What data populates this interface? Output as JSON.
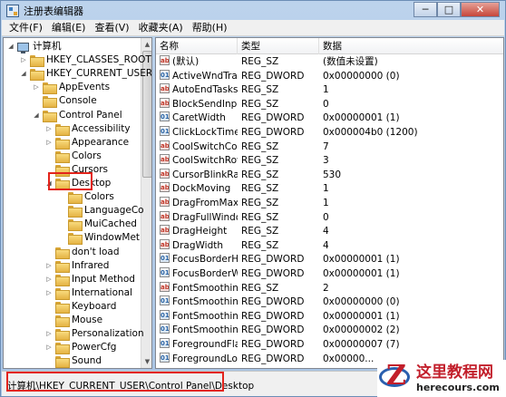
{
  "window": {
    "title": "注册表编辑器",
    "minimize": "─",
    "maximize": "□",
    "close": "✕"
  },
  "menu": [
    "文件(F)",
    "编辑(E)",
    "查看(V)",
    "收藏夹(A)",
    "帮助(H)"
  ],
  "tree": [
    {
      "label": "计算机",
      "icon": "computer-icon",
      "expander": "◢"
    },
    {
      "label": "HKEY_CLASSES_ROOT",
      "expander": "▷"
    },
    {
      "label": "HKEY_CURRENT_USER",
      "expander": "◢"
    },
    {
      "label": "AppEvents",
      "expander": "▷"
    },
    {
      "label": "Console",
      "expander": ""
    },
    {
      "label": "Control Panel",
      "expander": "◢"
    },
    {
      "label": "Accessibility",
      "expander": "▷"
    },
    {
      "label": "Appearance",
      "expander": "▷"
    },
    {
      "label": "Colors",
      "expander": ""
    },
    {
      "label": "Cursors",
      "expander": ""
    },
    {
      "label": "Desktop",
      "expander": "◢"
    },
    {
      "label": "Colors",
      "expander": ""
    },
    {
      "label": "LanguageCo",
      "expander": ""
    },
    {
      "label": "MuiCached",
      "expander": ""
    },
    {
      "label": "WindowMet",
      "expander": ""
    },
    {
      "label": "don't load",
      "expander": ""
    },
    {
      "label": "Infrared",
      "expander": "▷"
    },
    {
      "label": "Input Method",
      "expander": "▷"
    },
    {
      "label": "International",
      "expander": "▷"
    },
    {
      "label": "Keyboard",
      "expander": ""
    },
    {
      "label": "Mouse",
      "expander": ""
    },
    {
      "label": "Personalization",
      "expander": "▷"
    },
    {
      "label": "PowerCfg",
      "expander": "▷"
    },
    {
      "label": "Sound",
      "expander": ""
    }
  ],
  "list": {
    "headers": {
      "name": "名称",
      "type": "类型",
      "data": "数据"
    },
    "rows": [
      {
        "name": "(默认)",
        "type": "REG_SZ",
        "data": "(数值未设置)",
        "icon": "string-value-icon"
      },
      {
        "name": "ActiveWndTrac...",
        "type": "REG_DWORD",
        "data": "0x00000000 (0)",
        "icon": "dword-value-icon"
      },
      {
        "name": "AutoEndTasks",
        "type": "REG_SZ",
        "data": "1",
        "icon": "string-value-icon"
      },
      {
        "name": "BlockSendInpu...",
        "type": "REG_SZ",
        "data": "0",
        "icon": "string-value-icon"
      },
      {
        "name": "CaretWidth",
        "type": "REG_DWORD",
        "data": "0x00000001 (1)",
        "icon": "dword-value-icon"
      },
      {
        "name": "ClickLockTime",
        "type": "REG_DWORD",
        "data": "0x000004b0 (1200)",
        "icon": "dword-value-icon"
      },
      {
        "name": "CoolSwitchCol...",
        "type": "REG_SZ",
        "data": "7",
        "icon": "string-value-icon"
      },
      {
        "name": "CoolSwitchRows",
        "type": "REG_SZ",
        "data": "3",
        "icon": "string-value-icon"
      },
      {
        "name": "CursorBlinkRate",
        "type": "REG_SZ",
        "data": "530",
        "icon": "string-value-icon"
      },
      {
        "name": "DockMoving",
        "type": "REG_SZ",
        "data": "1",
        "icon": "string-value-icon"
      },
      {
        "name": "DragFromMaxi...",
        "type": "REG_SZ",
        "data": "1",
        "icon": "string-value-icon"
      },
      {
        "name": "DragFullWindo...",
        "type": "REG_SZ",
        "data": "0",
        "icon": "string-value-icon"
      },
      {
        "name": "DragHeight",
        "type": "REG_SZ",
        "data": "4",
        "icon": "string-value-icon"
      },
      {
        "name": "DragWidth",
        "type": "REG_SZ",
        "data": "4",
        "icon": "string-value-icon"
      },
      {
        "name": "FocusBorderH...",
        "type": "REG_DWORD",
        "data": "0x00000001 (1)",
        "icon": "dword-value-icon"
      },
      {
        "name": "FocusBorderW...",
        "type": "REG_DWORD",
        "data": "0x00000001 (1)",
        "icon": "dword-value-icon"
      },
      {
        "name": "FontSmoothing",
        "type": "REG_SZ",
        "data": "2",
        "icon": "string-value-icon"
      },
      {
        "name": "FontSmoothin...",
        "type": "REG_DWORD",
        "data": "0x00000000 (0)",
        "icon": "dword-value-icon"
      },
      {
        "name": "FontSmoothin...",
        "type": "REG_DWORD",
        "data": "0x00000001 (1)",
        "icon": "dword-value-icon"
      },
      {
        "name": "FontSmoothin...",
        "type": "REG_DWORD",
        "data": "0x00000002 (2)",
        "icon": "dword-value-icon"
      },
      {
        "name": "ForegroundFla...",
        "type": "REG_DWORD",
        "data": "0x00000007 (7)",
        "icon": "dword-value-icon"
      },
      {
        "name": "ForegroundLo...",
        "type": "REG_DWORD",
        "data": "0x00000...",
        "icon": "dword-value-icon"
      }
    ]
  },
  "status": {
    "path": "计算机\\HKEY_CURRENT_USER\\Control Panel\\Desktop"
  },
  "watermark": {
    "title": "这里教程网",
    "url": "herecours.com"
  },
  "colors": {
    "highlight": "#e3241b"
  }
}
